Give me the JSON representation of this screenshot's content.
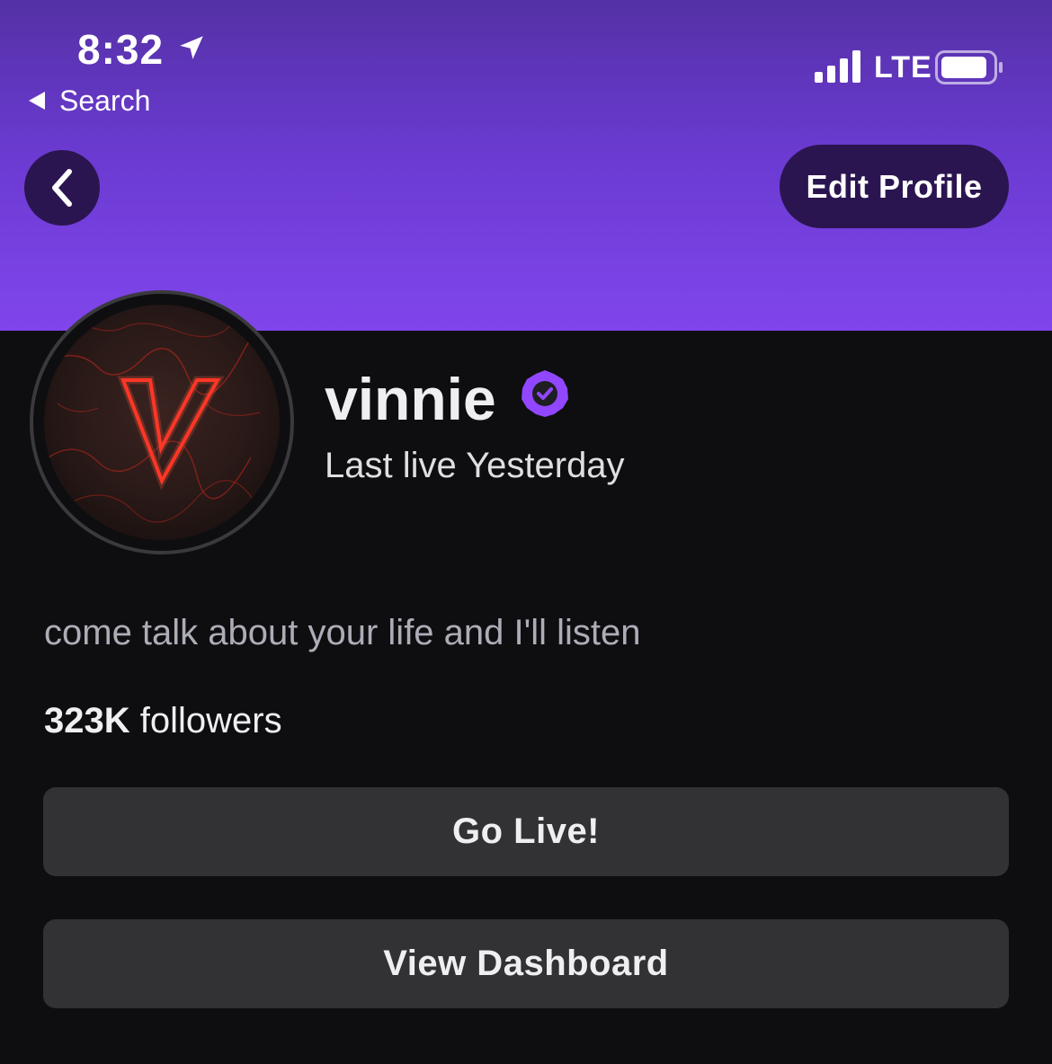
{
  "status_bar": {
    "time": "8:32",
    "back_app_label": "Search",
    "network": "LTE",
    "location_icon": "location-arrow-icon",
    "signal_icon": "signal-bars-icon",
    "battery_icon": "battery-icon"
  },
  "header": {
    "back_icon": "chevron-left-icon",
    "edit_profile_label": "Edit Profile",
    "gradient_colors": [
      "#5431a5",
      "#8045ec"
    ]
  },
  "profile": {
    "username": "vinnie",
    "verified_icon": "verified-badge-icon",
    "last_live": "Last live Yesterday",
    "bio": "come talk about your life and I'll listen",
    "followers_count": "323K",
    "followers_label": " followers",
    "accent_color": "#9147ff"
  },
  "actions": {
    "go_live_label": "Go Live!",
    "view_dashboard_label": "View Dashboard"
  }
}
